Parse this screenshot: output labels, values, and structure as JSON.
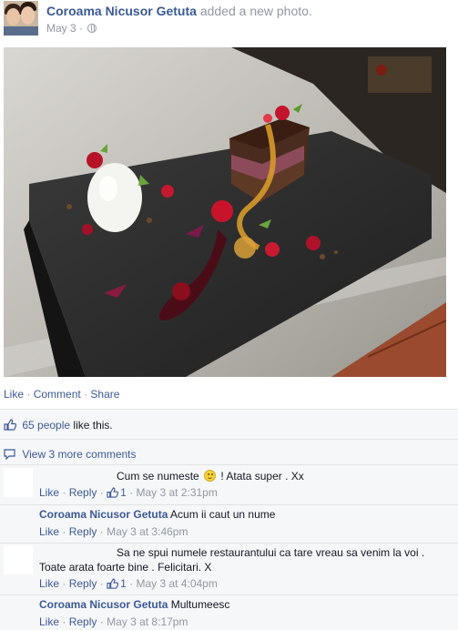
{
  "post": {
    "author": "Coroama Nicusor Getuta",
    "action": "added a new photo.",
    "date": "May 3",
    "separator": "·"
  },
  "actions": {
    "like": "Like",
    "comment": "Comment",
    "share": "Share",
    "sep": "·"
  },
  "likes": {
    "people": "65 people",
    "suffix": "like this."
  },
  "more_comments": "View 3 more comments",
  "comments": [
    {
      "text_before": "Cum se numeste",
      "text_after": "! Atata super . Xx",
      "like": "Like",
      "reply": "Reply",
      "likes": "1",
      "time": "May 3 at 2:31pm"
    },
    {
      "author": "Coroama Nicusor Getuta",
      "text": "Acum ii caut un nume",
      "like": "Like",
      "reply": "Reply",
      "time": "May 3 at 3:46pm"
    },
    {
      "text_line1": "Sa ne spui numele restaurantului ca tare vreau sa venim la voi .",
      "text_line2": "Toate arata foarte bine . Felicitari. X",
      "like": "Like",
      "reply": "Reply",
      "likes": "1",
      "time": "May 3 at 4:04pm"
    },
    {
      "author": "Coroama Nicusor Getuta",
      "text": "Multumeesc",
      "like": "Like",
      "reply": "Reply",
      "time": "May 3 at 8:17pm"
    }
  ],
  "icons": {
    "thumb": "thumbs-up-icon",
    "comment": "speech-bubble-icon",
    "globe": "globe-icon",
    "smiley": "smiley-emoticon-icon"
  },
  "colors": {
    "link": "#3b5998",
    "meta": "#9197a3",
    "ufi_bg": "#f6f7f9"
  }
}
